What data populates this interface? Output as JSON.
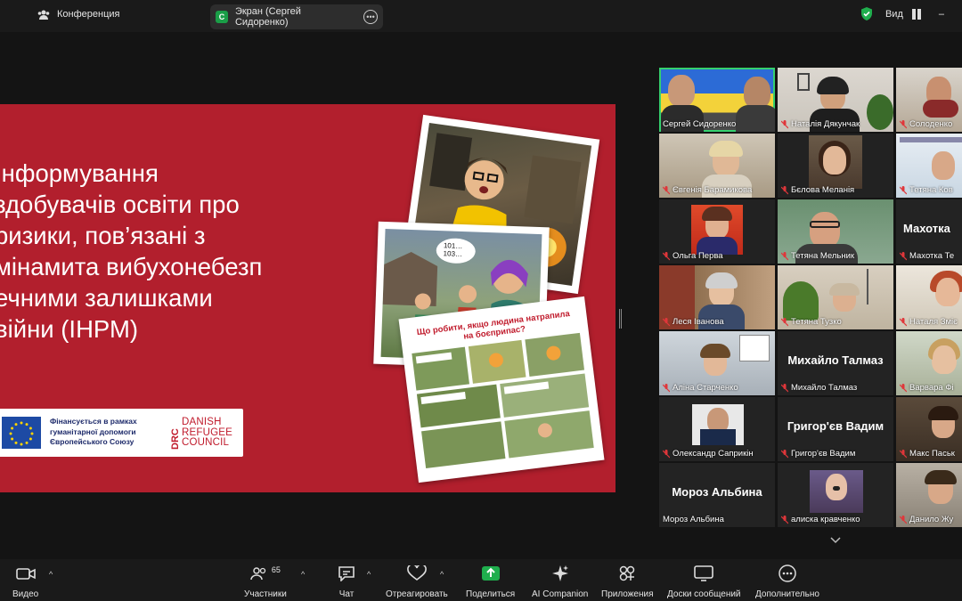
{
  "topbar": {
    "meeting_label": "Конференция",
    "share_label": "Экран (Сергей Сидоренко)",
    "share_badge": "С",
    "view_label": "Вид"
  },
  "slide": {
    "title_lines": [
      "Інформування",
      "здобувачів освіти про",
      "ризики, пов’язані з",
      "мінамита вибухонебезп",
      "ечними залишками",
      "війни (ІНРМ)"
    ],
    "funding_text": [
      "Фінансується в рамках",
      "гуманітарної допомоги",
      "Європейського Союзу"
    ],
    "drc_text": [
      "DANISH",
      "REFUGEE",
      "COUNCIL"
    ],
    "drc_mark": "DRC",
    "comic_bubble": [
      "101…",
      "103…"
    ],
    "comic_heading": [
      "Що робити, якщо людина натрапила",
      "на боєприпас?"
    ]
  },
  "participants": [
    {
      "name": "Сергей Сидоренко",
      "display": "video",
      "muted": false,
      "active": true
    },
    {
      "name": "Наталія Дякунчак",
      "display": "video",
      "muted": true
    },
    {
      "name": "Солоденко",
      "display": "video",
      "muted": true
    },
    {
      "name": "Євгенія Барамикова",
      "display": "video",
      "muted": true
    },
    {
      "name": "Бєлова Меланія",
      "display": "video",
      "muted": true
    },
    {
      "name": "Тетяна Ков",
      "display": "video",
      "muted": true
    },
    {
      "name": "Ольга Перва",
      "display": "video",
      "muted": true
    },
    {
      "name": "Тетяна Мельник",
      "display": "video",
      "muted": true
    },
    {
      "name": "Махотка Те",
      "display": "name",
      "big": "Махотка",
      "muted": true
    },
    {
      "name": "Леся Іванова",
      "display": "video",
      "muted": true
    },
    {
      "name": "Тетяна Тузко",
      "display": "video",
      "muted": true
    },
    {
      "name": "Наталя Зміє",
      "display": "video",
      "muted": true
    },
    {
      "name": "Аліна Старченко",
      "display": "video",
      "muted": true
    },
    {
      "name": "Михайло Талмаз",
      "display": "name",
      "big": "Михайло Талмаз",
      "muted": true
    },
    {
      "name": "Варвара Фі",
      "display": "video",
      "muted": true
    },
    {
      "name": "Олександр Саприкін",
      "display": "video",
      "muted": true
    },
    {
      "name": "Григор'єв Вадим",
      "display": "name",
      "big": "Григор'єв Вадим",
      "muted": true
    },
    {
      "name": "Макс Паськ",
      "display": "video",
      "muted": true
    },
    {
      "name": "Мороз Альбина",
      "display": "name",
      "big": "Мороз Альбина",
      "muted": false
    },
    {
      "name": "алиска кравченко",
      "display": "video",
      "muted": true
    },
    {
      "name": "Данило Жу",
      "display": "video",
      "muted": true
    }
  ],
  "toolbar": {
    "video": "Видео",
    "participants": "Участники",
    "participants_count": "65",
    "chat": "Чат",
    "react": "Отреагировать",
    "share": "Поделиться",
    "ai": "AI Companion",
    "apps": "Приложения",
    "whiteboards": "Доски сообщений",
    "more": "Дополнительно"
  },
  "colors": {
    "slide_red": "#b21f2d",
    "active_border": "#35d06e",
    "share_green": "#1a9e47",
    "muted_red": "#e0363a"
  }
}
